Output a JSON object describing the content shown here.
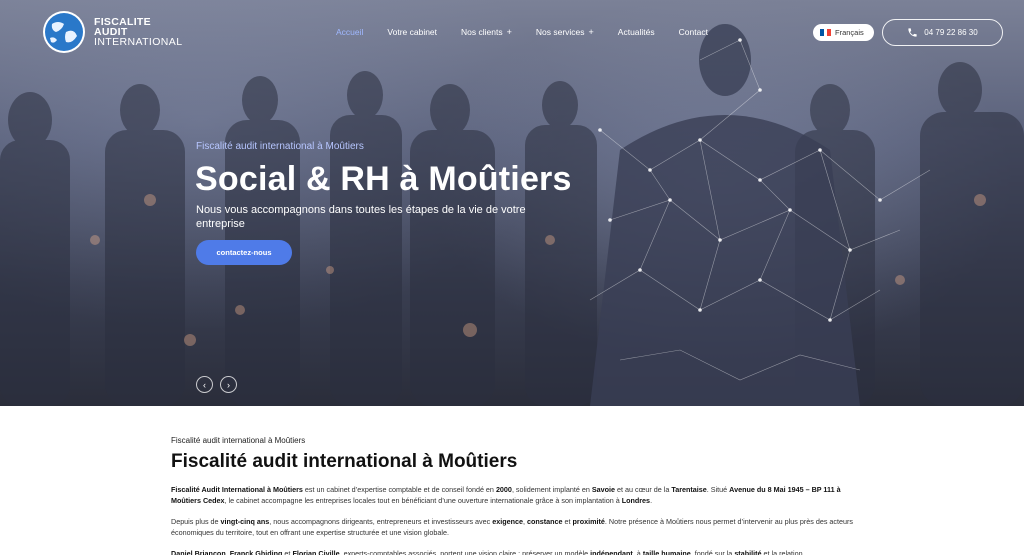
{
  "header": {
    "logo": {
      "line1": "FISCALITE",
      "line2": "AUDIT",
      "line3": "INTERNATIONAL"
    },
    "nav": [
      {
        "label": "Accueil",
        "active": true,
        "has_submenu": false
      },
      {
        "label": "Votre cabinet",
        "active": false,
        "has_submenu": false
      },
      {
        "label": "Nos clients",
        "active": false,
        "has_submenu": true
      },
      {
        "label": "Nos services",
        "active": false,
        "has_submenu": true
      },
      {
        "label": "Actualités",
        "active": false,
        "has_submenu": false
      },
      {
        "label": "Contact",
        "active": false,
        "has_submenu": false
      }
    ],
    "submenu_symbol": "+",
    "language": {
      "label": "Français",
      "flag_colors": [
        "#0055A4",
        "#FFFFFF",
        "#EF4135"
      ]
    },
    "phone": {
      "number": "04 79 22 86 30",
      "icon": "phone-icon"
    }
  },
  "hero": {
    "kicker": "Fiscalité audit international à Moûtiers",
    "title": "Social & RH à Moûtiers",
    "subtitle": "Nous vous accompagnons dans toutes les étapes de la vie de votre entreprise",
    "cta_label": "contactez-nous",
    "prev_symbol": "‹",
    "next_symbol": "›"
  },
  "content": {
    "kicker": "Fiscalité audit international à Moûtiers",
    "title": "Fiscalité audit international à Moûtiers",
    "p1": [
      {
        "t": "Fiscalité Audit International à Moûtiers",
        "b": true
      },
      {
        "t": " est un cabinet d’expertise comptable et de conseil fondé en ",
        "b": false
      },
      {
        "t": "2000",
        "b": true
      },
      {
        "t": ", solidement implanté en ",
        "b": false
      },
      {
        "t": "Savoie",
        "b": true
      },
      {
        "t": " et au cœur de la ",
        "b": false
      },
      {
        "t": "Tarentaise",
        "b": true
      },
      {
        "t": ". Situé ",
        "b": false
      },
      {
        "t": "Avenue du 8 Mai 1945 – BP 111 à Moûtiers Cedex",
        "b": true
      },
      {
        "t": ", le cabinet accompagne les entreprises locales tout en bénéficiant d’une ouverture internationale grâce à son implantation à ",
        "b": false
      },
      {
        "t": "Londres",
        "b": true
      },
      {
        "t": ".",
        "b": false
      }
    ],
    "p2": [
      {
        "t": "Depuis plus de ",
        "b": false
      },
      {
        "t": "vingt-cinq ans",
        "b": true
      },
      {
        "t": ", nous accompagnons dirigeants, entrepreneurs et investisseurs avec ",
        "b": false
      },
      {
        "t": "exigence",
        "b": true
      },
      {
        "t": ", ",
        "b": false
      },
      {
        "t": "constance",
        "b": true
      },
      {
        "t": " et ",
        "b": false
      },
      {
        "t": "proximité",
        "b": true
      },
      {
        "t": ". Notre présence à Moûtiers nous permet d’intervenir au plus près des acteurs économiques du territoire, tout en offrant une expertise structurée et une vision globale.",
        "b": false
      }
    ],
    "p3": [
      {
        "t": "Daniel Briancon",
        "b": true
      },
      {
        "t": ", ",
        "b": false
      },
      {
        "t": "Franck Ghiding",
        "b": true
      },
      {
        "t": " et ",
        "b": false
      },
      {
        "t": "Florian Civille",
        "b": true
      },
      {
        "t": ", experts-comptables associés, portent une vision claire : préserver un modèle ",
        "b": false
      },
      {
        "t": "indépendant",
        "b": true
      },
      {
        "t": ", à ",
        "b": false
      },
      {
        "t": "taille humaine",
        "b": true
      },
      {
        "t": ", fondé sur la ",
        "b": false
      },
      {
        "t": "stabilité",
        "b": true
      },
      {
        "t": " et la relation",
        "b": false
      }
    ]
  }
}
